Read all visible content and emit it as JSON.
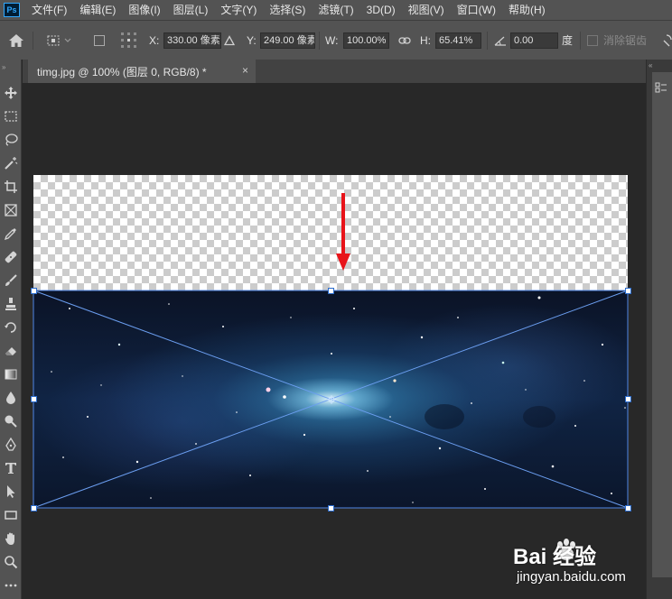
{
  "app": {
    "logo": "Ps"
  },
  "menu": [
    "文件(F)",
    "编辑(E)",
    "图像(I)",
    "图层(L)",
    "文字(Y)",
    "选择(S)",
    "滤镜(T)",
    "3D(D)",
    "视图(V)",
    "窗口(W)",
    "帮助(H)"
  ],
  "options_bar": {
    "x_label": "X:",
    "x_value": "330.00 像素",
    "y_label": "Y:",
    "y_value": "249.00 像素",
    "w_label": "W:",
    "w_value": "100.00%",
    "h_label": "H:",
    "h_value": "65.41%",
    "angle_value": "0.00",
    "angle_unit": "度",
    "antialias_label": "消除锯齿"
  },
  "document": {
    "tab_title": "timg.jpg @ 100% (图层 0, RGB/8) *",
    "close_glyph": "×"
  },
  "tools": [
    "move-tool",
    "marquee-tool",
    "lasso-tool",
    "magic-wand-tool",
    "crop-tool",
    "frame-tool",
    "eyedropper-tool",
    "healing-brush-tool",
    "brush-tool",
    "clone-stamp-tool",
    "history-brush-tool",
    "eraser-tool",
    "gradient-tool",
    "blur-tool",
    "dodge-tool",
    "pen-tool",
    "type-tool",
    "path-selection-tool",
    "rectangle-tool",
    "hand-tool",
    "zoom-tool",
    "more-tools"
  ],
  "colors": {
    "ui_dark": "#535353",
    "canvas_bg": "#282828",
    "arrow": "#e8141a",
    "transform_line": "#4f86e6"
  },
  "watermark": {
    "brand": "Bai 经验",
    "url": "jingyan.baidu.com"
  }
}
